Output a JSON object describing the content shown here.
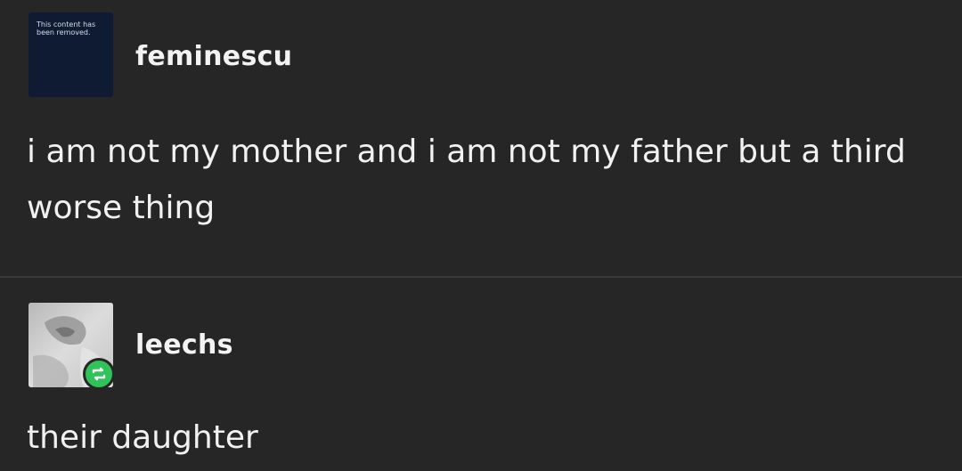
{
  "posts": [
    {
      "username": "feminescu",
      "avatar": {
        "removed_text": "This content has been removed."
      },
      "body": "i am not my mother and i am not my father but a third worse thing"
    },
    {
      "username": "leechs",
      "body": "their daughter",
      "badge_icon": "reblog-icon"
    }
  ],
  "colors": {
    "background": "#262626",
    "text": "#f1f1f1",
    "reblog_badge": "#2fc35a",
    "removed_avatar_bg": "#0f1a33"
  }
}
